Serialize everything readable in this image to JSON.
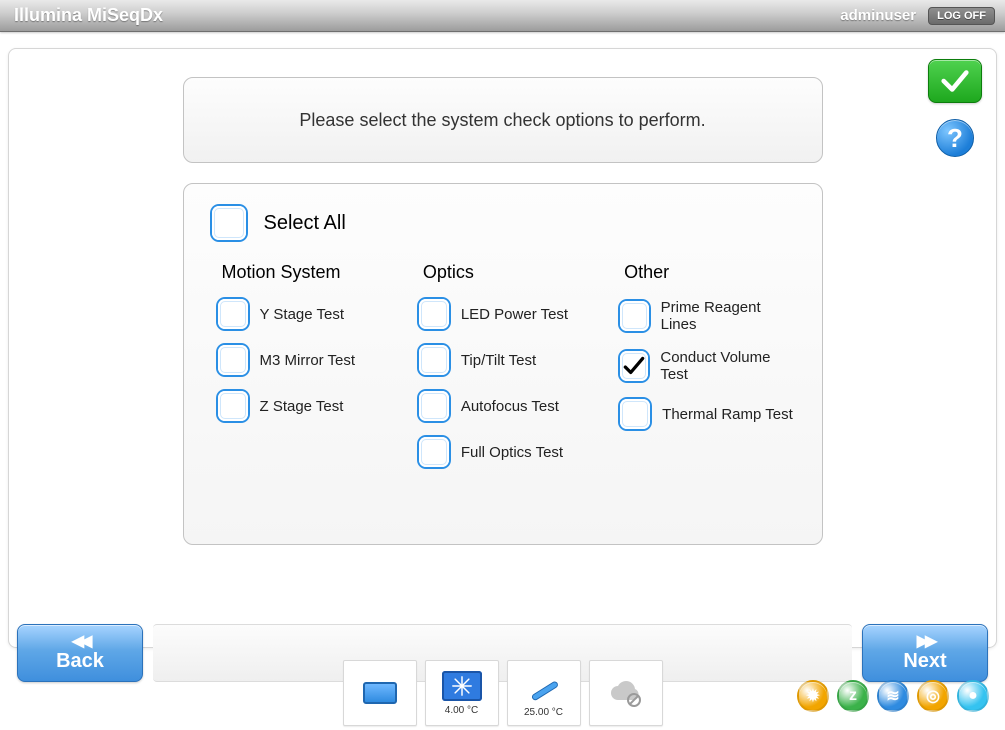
{
  "header": {
    "title": "Illumina MiSeqDx",
    "user": "adminuser",
    "logoff_label": "LOG OFF"
  },
  "side": {
    "ok_icon": "checkmark-icon",
    "help_glyph": "?"
  },
  "instruction": "Please select the system check options to perform.",
  "options": {
    "select_all": {
      "label": "Select All",
      "checked": false
    },
    "columns": [
      {
        "header": "Motion System",
        "items": [
          {
            "label": "Y Stage Test",
            "checked": false
          },
          {
            "label": "M3 Mirror Test",
            "checked": false
          },
          {
            "label": "Z Stage Test",
            "checked": false
          }
        ]
      },
      {
        "header": "Optics",
        "items": [
          {
            "label": "LED Power Test",
            "checked": false
          },
          {
            "label": "Tip/Tilt Test",
            "checked": false
          },
          {
            "label": "Autofocus Test",
            "checked": false
          },
          {
            "label": "Full Optics Test",
            "checked": false
          }
        ]
      },
      {
        "header": "Other",
        "items": [
          {
            "label": "Prime Reagent Lines",
            "checked": false
          },
          {
            "label": "Conduct Volume Test",
            "checked": true
          },
          {
            "label": "Thermal Ramp Test",
            "checked": false
          }
        ]
      }
    ]
  },
  "nav": {
    "back_label": "Back",
    "next_label": "Next"
  },
  "tray": {
    "chiller_temp": "4.00 °C",
    "flowcell_temp": "25.00 °C",
    "coins": [
      {
        "name": "status-motion-icon",
        "color": "#f2a500",
        "glyph": "✹"
      },
      {
        "name": "status-zstage-icon",
        "color": "#3bb24a",
        "glyph": "z"
      },
      {
        "name": "status-optics-icon",
        "color": "#2f8be0",
        "glyph": "≋"
      },
      {
        "name": "status-camera-icon",
        "color": "#f2a500",
        "glyph": "◎"
      },
      {
        "name": "status-fluidics-icon",
        "color": "#35c3f0",
        "glyph": "●"
      }
    ]
  }
}
